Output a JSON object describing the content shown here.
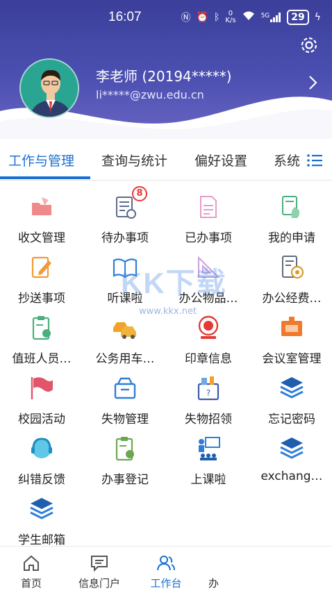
{
  "statusbar": {
    "time": "16:07",
    "net_speed_value": "0",
    "net_speed_unit": "K/s",
    "signal_label": "5G",
    "battery": "29"
  },
  "profile": {
    "name": "李老师 (20194*****)",
    "email": "li*****@zwu.edu.cn"
  },
  "tabs": [
    {
      "label": "工作与管理",
      "active": true
    },
    {
      "label": "查询与统计",
      "active": false
    },
    {
      "label": "偏好设置",
      "active": false
    },
    {
      "label": "系统",
      "active": false
    }
  ],
  "apps": [
    {
      "label": "收文管理",
      "icon": "folder-open-icon"
    },
    {
      "label": "待办事项",
      "icon": "todo-list-icon",
      "badge": "8"
    },
    {
      "label": "已办事项",
      "icon": "document-icon"
    },
    {
      "label": "我的申请",
      "icon": "hand-document-icon"
    },
    {
      "label": "抄送事项",
      "icon": "edit-document-icon"
    },
    {
      "label": "听课啦",
      "icon": "open-book-icon"
    },
    {
      "label": "办公物品…",
      "icon": "office-supplies-icon"
    },
    {
      "label": "办公经费…",
      "icon": "finance-icon"
    },
    {
      "label": "值班人员…",
      "icon": "duty-clipboard-icon"
    },
    {
      "label": "公务用车…",
      "icon": "car-icon"
    },
    {
      "label": "印章信息",
      "icon": "seal-icon"
    },
    {
      "label": "会议室管理",
      "icon": "meeting-room-icon"
    },
    {
      "label": "校园活动",
      "icon": "flag-icon"
    },
    {
      "label": "失物管理",
      "icon": "box-icon"
    },
    {
      "label": "失物招领",
      "icon": "lost-found-icon"
    },
    {
      "label": "忘记密码",
      "icon": "layers-icon"
    },
    {
      "label": "纠错反馈",
      "icon": "headset-icon"
    },
    {
      "label": "办事登记",
      "icon": "register-clipboard-icon"
    },
    {
      "label": "上课啦",
      "icon": "classroom-icon"
    },
    {
      "label": "exchang…",
      "icon": "layers-icon"
    },
    {
      "label": "学生邮箱",
      "icon": "layers-icon"
    }
  ],
  "watermark": {
    "logo": "KK下载",
    "url": "www.kkx.net"
  },
  "bottom_nav": [
    {
      "label": "首页",
      "icon": "home-icon",
      "active": false
    },
    {
      "label": "信息门户",
      "icon": "message-icon",
      "active": false
    },
    {
      "label": "工作台",
      "icon": "workbench-icon",
      "active": true
    },
    {
      "label": "办",
      "icon": "more-icon",
      "active": false
    }
  ],
  "colors": {
    "header": "#3b3f9a",
    "accent": "#1a6fd1",
    "badge": "#e53935"
  }
}
